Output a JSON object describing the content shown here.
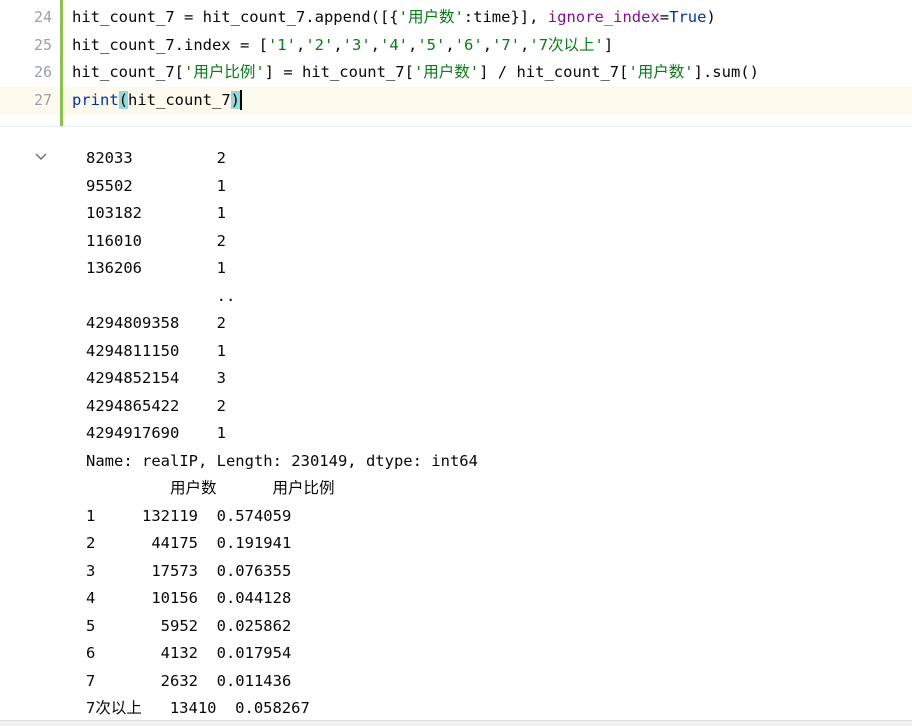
{
  "editor": {
    "line_numbers": [
      "24",
      "25",
      "26",
      "27"
    ],
    "line24": {
      "a": "hit_count_7 = hit_count_7.append([{",
      "s1": "'用户数'",
      "b": ":time}], ",
      "p": "ignore_index",
      "c": "=",
      "k": "True",
      "d": ")"
    },
    "line25": {
      "a": "hit_count_7.index = [",
      "s1": "'1'",
      "s2": "'2'",
      "s3": "'3'",
      "s4": "'4'",
      "s5": "'5'",
      "s6": "'6'",
      "s7": "'7'",
      "s8": "'7次以上'",
      "comma": ",",
      "end": "]"
    },
    "line26": {
      "a": "hit_count_7[",
      "s1": "'用户比例'",
      "b": "] = hit_count_7[",
      "s2": "'用户数'",
      "c": "] / hit_count_7[",
      "s3": "'用户数'",
      "d": "].sum()"
    },
    "line27": {
      "a": "print",
      "open": "(",
      "b": "hit_count_7",
      "close": ")"
    }
  },
  "output": {
    "lines": [
      "82033         2",
      "95502         1",
      "103182        1",
      "116010        2",
      "136206        1",
      "              ..",
      "4294809358    2",
      "4294811150    1",
      "4294852154    3",
      "4294865422    2",
      "4294917690    1",
      "Name: realIP, Length: 230149, dtype: int64",
      "         用户数      用户比例",
      "1     132119  0.574059",
      "2      44175  0.191941",
      "3      17573  0.076355",
      "4      10156  0.044128",
      "5       5952  0.025862",
      "6       4132  0.017954",
      "7       2632  0.011436",
      "7次以上   13410  0.058267"
    ]
  },
  "icons": {
    "collapse": "chevron-down-icon"
  },
  "colors": {
    "gutter_border": "#8bc34a",
    "string": "#067d17",
    "keyword": "#0033b3",
    "param": "#871094",
    "brace_match": "#93d9d9"
  }
}
